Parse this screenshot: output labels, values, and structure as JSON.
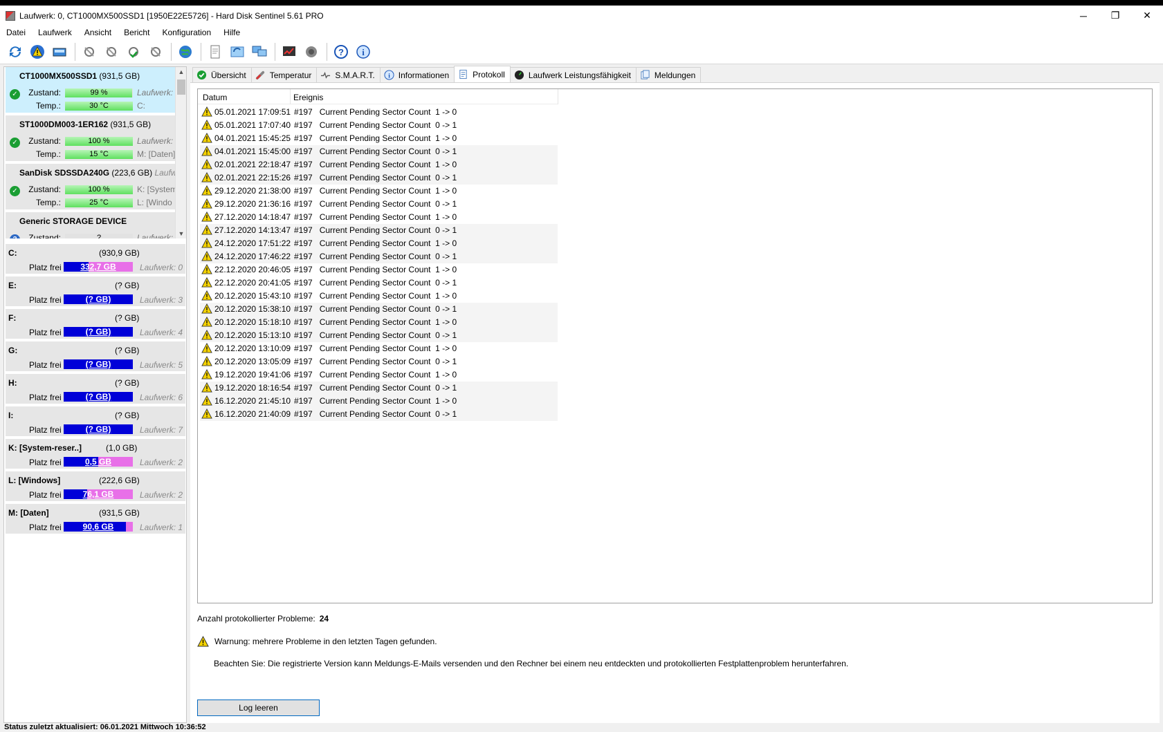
{
  "window": {
    "title": "Laufwerk: 0, CT1000MX500SSD1 [1950E22E5726]  -  Hard Disk Sentinel 5.61 PRO",
    "minimize": "─",
    "maximize": "❐",
    "close": "✕"
  },
  "menu": [
    "Datei",
    "Laufwerk",
    "Ansicht",
    "Bericht",
    "Konfiguration",
    "Hilfe"
  ],
  "toolbar_icons": [
    "refresh-icon",
    "warning-icon",
    "disk-info-icon",
    "disk-test-1-icon",
    "disk-test-2-icon",
    "disk-test-3-icon",
    "disk-test-4-icon",
    "globe-icon",
    "document-icon",
    "sync-icon",
    "network-icon",
    "chart-icon",
    "sound-icon",
    "help-icon",
    "info-icon"
  ],
  "disks": [
    {
      "name": "CT1000MX500SSD1",
      "size": "(931,5 GB)",
      "state_label": "Zustand:",
      "health": "99 %",
      "health_value": 99,
      "temp_label": "Temp.:",
      "temp": "30 °C",
      "temp_value": 30,
      "right1": "Laufwerk:",
      "right2": "C:",
      "status": "ok"
    },
    {
      "name": "ST1000DM003-1ER162",
      "size": "(931,5 GB)",
      "state_label": "Zustand:",
      "health": "100 %",
      "health_value": 100,
      "temp_label": "Temp.:",
      "temp": "15 °C",
      "temp_value": 15,
      "right1": "Laufwerk:",
      "right2": "M: [Daten]",
      "status": "ok"
    },
    {
      "name": "SanDisk SDSSDA240G",
      "size": "(223,6 GB)",
      "size_suffix": "Laufwe",
      "state_label": "Zustand:",
      "health": "100 %",
      "health_value": 100,
      "temp_label": "Temp.:",
      "temp": "25 °C",
      "temp_value": 25,
      "right1": "K: [System",
      "right2": "L: [Windo",
      "status": "ok"
    },
    {
      "name": "Generic STORAGE DEVICE",
      "size": "",
      "state_label": "Zustand:",
      "health": "?",
      "health_value": 0,
      "right1": "Laufwerk:",
      "status": "unknown"
    }
  ],
  "partitions": [
    {
      "letter": "C:",
      "size": "(930,9 GB)",
      "free_label": "Platz frei",
      "free": "332,7 GB",
      "free_fraction": 0.36,
      "drive": "Laufwerk: 0"
    },
    {
      "letter": "E:",
      "size": "(? GB)",
      "free_label": "Platz frei",
      "free": "(? GB)",
      "free_fraction": 1.0,
      "drive": "Laufwerk: 3"
    },
    {
      "letter": "F:",
      "size": "(? GB)",
      "free_label": "Platz frei",
      "free": "(? GB)",
      "free_fraction": 1.0,
      "drive": "Laufwerk: 4"
    },
    {
      "letter": "G:",
      "size": "(? GB)",
      "free_label": "Platz frei",
      "free": "(? GB)",
      "free_fraction": 1.0,
      "drive": "Laufwerk: 5"
    },
    {
      "letter": "H:",
      "size": "(? GB)",
      "free_label": "Platz frei",
      "free": "(? GB)",
      "free_fraction": 1.0,
      "drive": "Laufwerk: 6"
    },
    {
      "letter": "I:",
      "size": "(? GB)",
      "free_label": "Platz frei",
      "free": "(? GB)",
      "free_fraction": 1.0,
      "drive": "Laufwerk: 7"
    },
    {
      "letter": "K: [System-reser..]",
      "size": "(1,0 GB)",
      "free_label": "Platz frei",
      "free": "0,5 GB",
      "free_fraction": 0.5,
      "drive": "Laufwerk: 2"
    },
    {
      "letter": "L: [Windows]",
      "size": "(222,6 GB)",
      "free_label": "Platz frei",
      "free": "76,1 GB",
      "free_fraction": 0.34,
      "drive": "Laufwerk: 2"
    },
    {
      "letter": "M: [Daten]",
      "size": "(931,5 GB)",
      "free_label": "Platz frei",
      "free": "90,6 GB",
      "free_fraction": 0.9,
      "drive": "Laufwerk: 1"
    }
  ],
  "tabs": [
    {
      "label": "Übersicht",
      "icon": "check-icon",
      "active": false
    },
    {
      "label": "Temperatur",
      "icon": "thermometer-icon",
      "active": false
    },
    {
      "label": "S.M.A.R.T.",
      "icon": "smart-icon",
      "active": false
    },
    {
      "label": "Informationen",
      "icon": "info-icon",
      "active": false
    },
    {
      "label": "Protokoll",
      "icon": "log-icon",
      "active": true
    },
    {
      "label": "Laufwerk Leistungsfähigkeit",
      "icon": "performance-icon",
      "active": false
    },
    {
      "label": "Meldungen",
      "icon": "messages-icon",
      "active": false
    }
  ],
  "log": {
    "columns": [
      "Datum",
      "Ereignis"
    ],
    "rows": [
      {
        "date": "05.01.2021 17:09:51",
        "event": "#197   Current Pending Sector Count  1 -> 0"
      },
      {
        "date": "05.01.2021 17:07:40",
        "event": "#197   Current Pending Sector Count  0 -> 1"
      },
      {
        "date": "04.01.2021 15:45:25",
        "event": "#197   Current Pending Sector Count  1 -> 0"
      },
      {
        "date": "04.01.2021 15:45:00",
        "event": "#197   Current Pending Sector Count  0 -> 1"
      },
      {
        "date": "02.01.2021 22:18:47",
        "event": "#197   Current Pending Sector Count  1 -> 0"
      },
      {
        "date": "02.01.2021 22:15:26",
        "event": "#197   Current Pending Sector Count  0 -> 1"
      },
      {
        "date": "29.12.2020 21:38:00",
        "event": "#197   Current Pending Sector Count  1 -> 0"
      },
      {
        "date": "29.12.2020 21:36:16",
        "event": "#197   Current Pending Sector Count  0 -> 1"
      },
      {
        "date": "27.12.2020 14:18:47",
        "event": "#197   Current Pending Sector Count  1 -> 0"
      },
      {
        "date": "27.12.2020 14:13:47",
        "event": "#197   Current Pending Sector Count  0 -> 1"
      },
      {
        "date": "24.12.2020 17:51:22",
        "event": "#197   Current Pending Sector Count  1 -> 0"
      },
      {
        "date": "24.12.2020 17:46:22",
        "event": "#197   Current Pending Sector Count  0 -> 1"
      },
      {
        "date": "22.12.2020 20:46:05",
        "event": "#197   Current Pending Sector Count  1 -> 0"
      },
      {
        "date": "22.12.2020 20:41:05",
        "event": "#197   Current Pending Sector Count  0 -> 1"
      },
      {
        "date": "20.12.2020 15:43:10",
        "event": "#197   Current Pending Sector Count  1 -> 0"
      },
      {
        "date": "20.12.2020 15:38:10",
        "event": "#197   Current Pending Sector Count  0 -> 1"
      },
      {
        "date": "20.12.2020 15:18:10",
        "event": "#197   Current Pending Sector Count  1 -> 0"
      },
      {
        "date": "20.12.2020 15:13:10",
        "event": "#197   Current Pending Sector Count  0 -> 1"
      },
      {
        "date": "20.12.2020 13:10:09",
        "event": "#197   Current Pending Sector Count  1 -> 0"
      },
      {
        "date": "20.12.2020 13:05:09",
        "event": "#197   Current Pending Sector Count  0 -> 1"
      },
      {
        "date": "19.12.2020 19:41:06",
        "event": "#197   Current Pending Sector Count  1 -> 0"
      },
      {
        "date": "19.12.2020 18:16:54",
        "event": "#197   Current Pending Sector Count  0 -> 1"
      },
      {
        "date": "16.12.2020 21:45:10",
        "event": "#197   Current Pending Sector Count  1 -> 0"
      },
      {
        "date": "16.12.2020 21:40:09",
        "event": "#197   Current Pending Sector Count  0 -> 1"
      }
    ]
  },
  "summary": {
    "label": "Anzahl protokollierter Probleme:",
    "count": "24"
  },
  "warning": "Warnung: mehrere Probleme in den letzten Tagen gefunden.",
  "note": "Beachten Sie: Die registrierte Version kann Meldungs-E-Mails versenden und den Rechner bei einem neu entdeckten und protokollierten Festplattenproblem herunterfahren.",
  "clear_button": "Log leeren",
  "status_bar": "Status zuletzt aktualisiert: 06.01.2021 Mittwoch 10:36:52",
  "colors": {
    "ok": "#1a9e33",
    "warning": "#f5d300",
    "free_bar": "#0000d8",
    "used_bar": "#e870e8",
    "health_bar": "#5fe05f",
    "selected": "#cdeffd"
  }
}
